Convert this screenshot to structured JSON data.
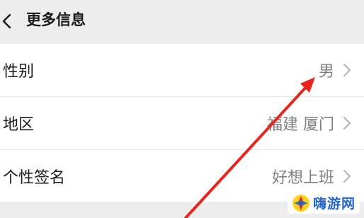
{
  "header": {
    "title": "更多信息",
    "back_icon": "chevron-left-icon"
  },
  "rows": [
    {
      "label": "性别",
      "value": "男"
    },
    {
      "label": "地区",
      "value": "福建 厦门"
    },
    {
      "label": "个性签名",
      "value": "好想上班"
    }
  ],
  "watermark": {
    "text": "嗨游网"
  },
  "colors": {
    "background": "#ededed",
    "row_background": "#ffffff",
    "value_text": "#7f7f7f",
    "annotation_arrow": "#e8241c",
    "watermark_text": "#1f64c8"
  }
}
